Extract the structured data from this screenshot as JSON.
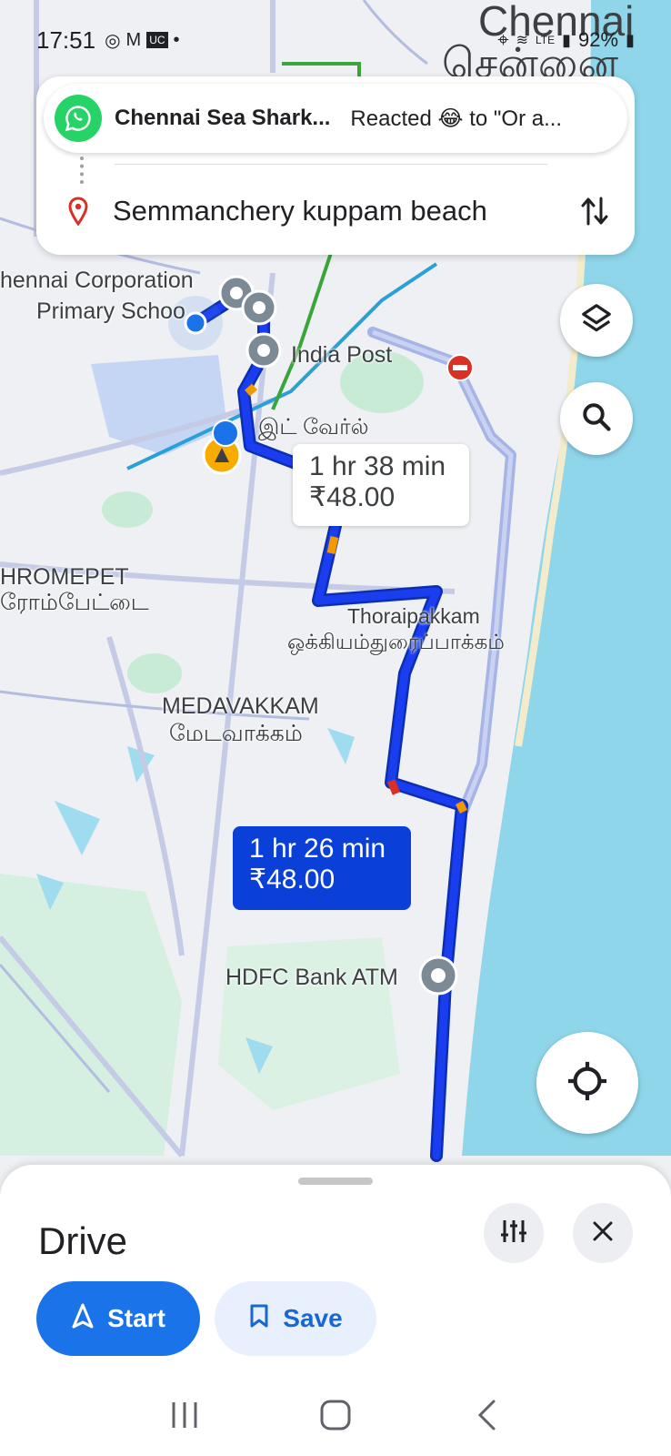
{
  "status_bar": {
    "time": "17:51",
    "battery": "92%",
    "network": "LTE",
    "icons": [
      "whatsapp-icon",
      "gmail-icon",
      "uc-icon",
      "dot-icon",
      "location-icon",
      "wifi-icon",
      "signal-icon",
      "battery-icon"
    ]
  },
  "notification": {
    "app_icon": "whatsapp-icon",
    "title": "Chennai Sea Shark...",
    "message": "Reacted 😂 to \"Or a..."
  },
  "search": {
    "destination": "Semmanchery kuppam beach",
    "pin_icon": "location-pin-icon",
    "swap_icon": "swap-vert-icon"
  },
  "map": {
    "city_label_en": "Chennai",
    "city_label_ta": "சென்னை",
    "labels": {
      "corporation_school_1": "hennai Corporation",
      "corporation_school_2": "Primary Schoo",
      "india_post": "India Post",
      "tamil_place": "இட் வேர்ல்",
      "chromepet_en": "HROMEPET",
      "chromepet_ta": "ரோம்பேட்டை",
      "thoraipakkam_en": "Thoraipakkam",
      "thoraipakkam_ta": "ஒக்கியம்துரைப்பாக்கம்",
      "medavakkam_en": "MEDAVAKKAM",
      "medavakkam_ta": "மேடவாக்கம்",
      "hdfc": "HDFC Bank ATM"
    },
    "alt_route": {
      "time": "1 hr 38 min",
      "fare": "₹48.00"
    },
    "main_route": {
      "time": "1 hr 26 min",
      "fare": "₹48.00"
    },
    "colors": {
      "route": "#1a3df0",
      "alt_route": "#a6b4e6",
      "sea": "#8fd6ea",
      "land": "#eef0f3",
      "park": "#c8ebd6"
    }
  },
  "controls": {
    "layers_icon": "layers-icon",
    "search_icon": "search-icon",
    "my_location_icon": "my-location-icon"
  },
  "sheet": {
    "title": "Drive",
    "start_label": "Start",
    "save_label": "Save",
    "options_icon": "tune-icon",
    "close_icon": "close-icon"
  },
  "navbar": {
    "icons": [
      "recents-icon",
      "home-icon",
      "back-icon"
    ]
  }
}
